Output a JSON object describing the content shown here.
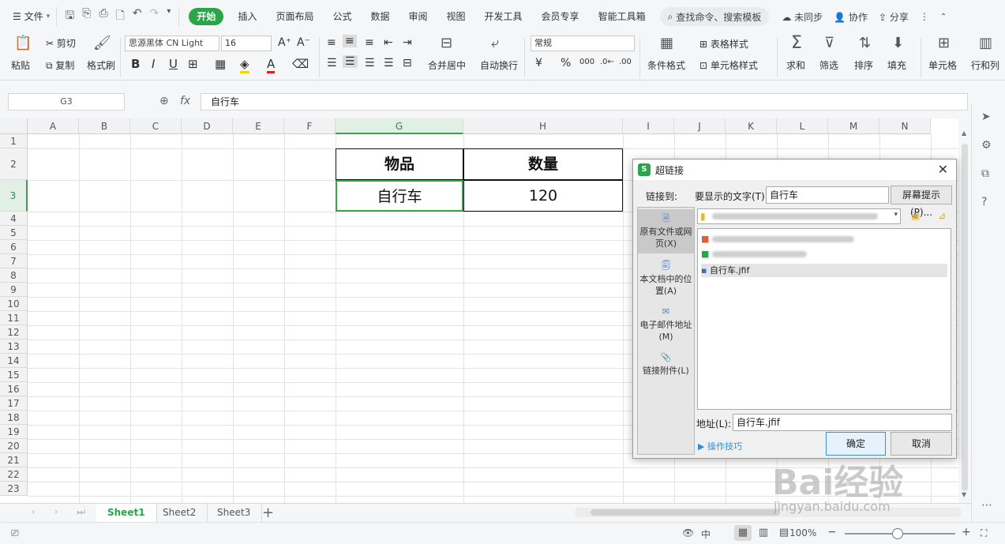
{
  "menubar": {
    "file_label": "文件",
    "tabs": [
      "开始",
      "插入",
      "页面布局",
      "公式",
      "数据",
      "审阅",
      "视图",
      "开发工具",
      "会员专享",
      "智能工具箱"
    ],
    "active_tab": "开始",
    "search_label": "查找命令、搜索模板",
    "unsynced_label": "未同步",
    "collab_label": "协作",
    "share_label": "分享"
  },
  "ribbon": {
    "paste": "粘贴",
    "cut": "剪切",
    "copy": "复制",
    "format_painter": "格式刷",
    "font_name": "思源黑体 CN Light",
    "font_size": "16",
    "merge_center": "合并居中",
    "wrap_text": "自动换行",
    "number_format": "常规",
    "cond_format": "条件格式",
    "table_style": "表格样式",
    "cell_style": "单元格样式",
    "sum": "求和",
    "filter": "筛选",
    "sort": "排序",
    "fill": "填充",
    "cell": "单元格",
    "row_col": "行和列"
  },
  "formula_bar": {
    "cell_ref": "G3",
    "content": "自行车"
  },
  "sheet": {
    "columns": [
      "A",
      "B",
      "C",
      "D",
      "E",
      "F",
      "G",
      "H",
      "I",
      "J",
      "K",
      "L",
      "M",
      "N"
    ],
    "rows": [
      "1",
      "2",
      "3",
      "4",
      "5",
      "6",
      "7",
      "8",
      "9",
      "10",
      "11",
      "12",
      "13",
      "14",
      "15",
      "16",
      "17",
      "18",
      "19",
      "20",
      "21",
      "22",
      "23"
    ],
    "table": {
      "header_item": "物品",
      "header_qty": "数量",
      "item": "自行车",
      "qty": "120"
    }
  },
  "tabs": [
    "Sheet1",
    "Sheet2",
    "Sheet3"
  ],
  "active_sheet": "Sheet1",
  "status": {
    "zoom": "100%"
  },
  "dialog": {
    "title": "超链接",
    "link_to_label": "链接到:",
    "display_text_label": "要显示的文字(T):",
    "display_text_value": "自行车",
    "screen_tip_btn": "屏幕提示(P)...",
    "nav": [
      "原有文件或网页(X)",
      "本文档中的位置(A)",
      "电子邮件地址(M)",
      "链接附件(L)"
    ],
    "file_selected": "自行车.jfif",
    "address_label": "地址(L):",
    "address_value": "自行车.jfif",
    "ok": "确定",
    "cancel": "取消",
    "tips": "操作技巧"
  },
  "watermark": {
    "brand": "Bai经验",
    "url": "jingyan.baidu.com"
  },
  "colors": {
    "accent": "#2aa54a",
    "selection": "#3aa150"
  }
}
